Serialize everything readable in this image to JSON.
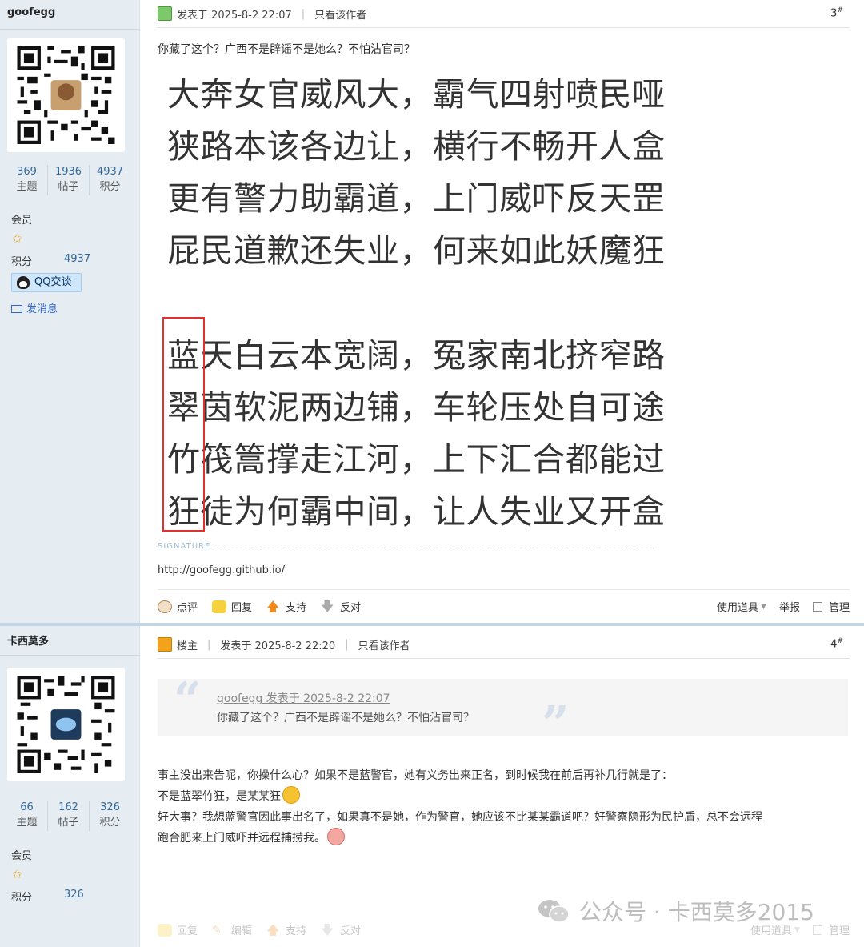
{
  "posts": [
    {
      "author": "goofegg",
      "stats": [
        {
          "num": "369",
          "label": "主题"
        },
        {
          "num": "1936",
          "label": "帖子"
        },
        {
          "num": "4937",
          "label": "积分"
        }
      ],
      "role": "会员",
      "points_label": "积分",
      "points_value": "4937",
      "qq_label": "QQ交谈",
      "message_label": "发消息",
      "posted": "发表于 2025-8-2 22:07",
      "only_author": "只看该作者",
      "floor": "3",
      "text": "你藏了这个？广西不是辟谣不是她么？不怕沾官司？",
      "poem": [
        "大奔女官威风大，霸气四射喷民哑",
        "狭路本该各边让，横行不畅开人盒",
        "更有警力助霸道，上门威吓反天罡",
        "屁民道歉还失业，何来如此妖魔狂",
        "蓝天白云本宽阔，冤家南北挤窄路",
        "翠茵软泥两边铺，车轮压处自可途",
        "竹筏篙撑走江河，上下汇合都能过",
        "狂徒为何霸中间，让人失业又开盒"
      ],
      "signature_label": "SIGNATURE",
      "signature_url": "http://goofegg.github.io/",
      "actions": [
        "点评",
        "回复",
        "支持",
        "反对"
      ],
      "actions_right": [
        "使用道具",
        "举报",
        "管理"
      ]
    },
    {
      "author": "卡西莫多",
      "stats": [
        {
          "num": "66",
          "label": "主题"
        },
        {
          "num": "162",
          "label": "帖子"
        },
        {
          "num": "326",
          "label": "积分"
        }
      ],
      "role": "会员",
      "points_label": "积分",
      "points_value": "326",
      "owner_label": "楼主",
      "posted": "发表于 2025-8-2 22:20",
      "only_author": "只看该作者",
      "floor": "4",
      "quote_head": "goofegg 发表于 2025-8-2 22:07",
      "quote_body": "你藏了这个？广西不是辟谣不是她么？不怕沾官司？",
      "reply_line1": "事主没出来告呢，你操什么心？如果不是蓝警官，她有义务出来正名，到时候我在前后再补几行就是了：",
      "reply_line2": "不是蓝翠竹狂，是某某狂",
      "reply_line3": "好大事？我想蓝警官因此事出名了，如果真不是她，作为警官，她应该不比某某霸道吧？好警察隐形为民护盾，总不会远程",
      "reply_line4": "跑合肥来上门威吓并远程捕捞我。",
      "actions": [
        "回复",
        "编辑",
        "支持",
        "反对"
      ],
      "actions_right": [
        "使用道具",
        "管理"
      ]
    }
  ],
  "watermark": "公众号 · 卡西莫多2015"
}
